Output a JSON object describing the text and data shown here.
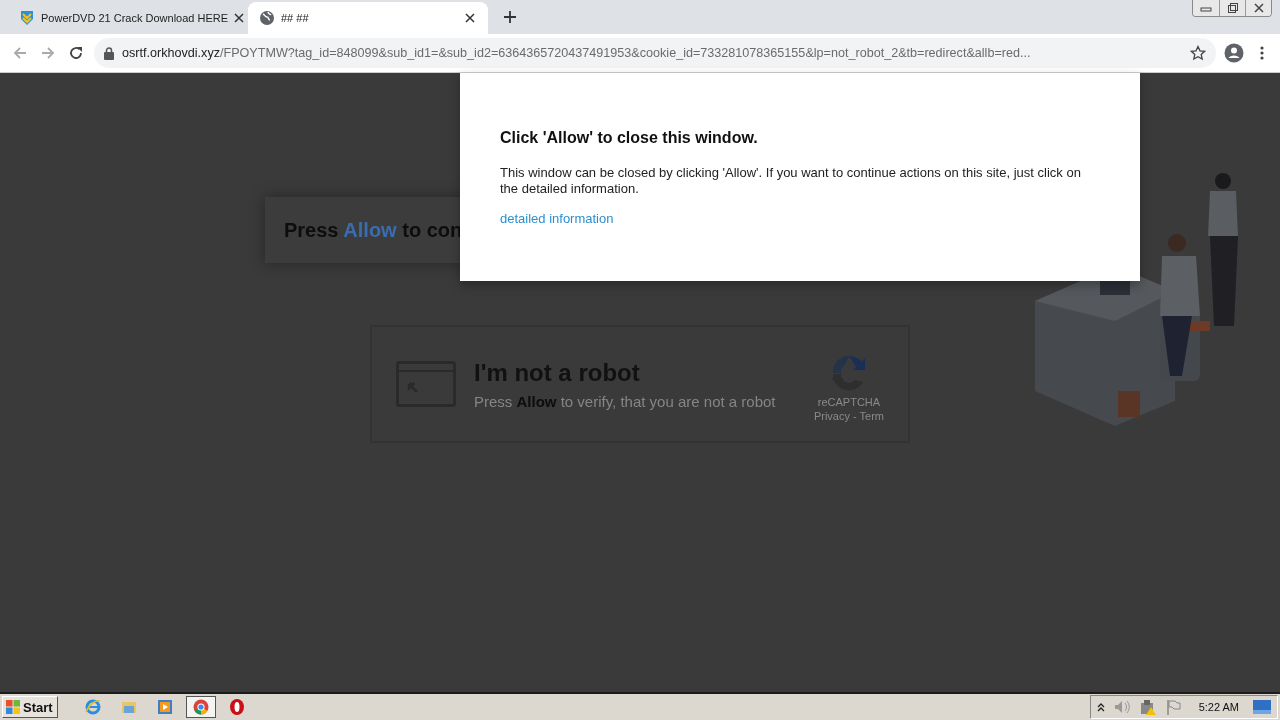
{
  "tabs": [
    {
      "label": "PowerDVD 21 Crack Download HERE",
      "kind": "shield",
      "selected": false
    },
    {
      "label": "## ##",
      "kind": "globe",
      "selected": true
    }
  ],
  "address_bar": {
    "host": "osrtf.orkhovdi.xyz",
    "path": "/FPOYTMW?tag_id=848099&sub_id1=&sub_id2=6364365720437491953&cookie_id=733281078365155&lp=not_robot_2&tb=redirect&allb=red..."
  },
  "page": {
    "press_card": {
      "before": "Press",
      "highlight": "Allow",
      "after": "to con"
    },
    "captcha": {
      "title": "I'm not a robot",
      "subtitle": "Press **Allow** to verify, that you are not a robot",
      "brand": "reCAPTCHA",
      "links": "Privacy - Term"
    }
  },
  "popup": {
    "title": "Click 'Allow' to close this window.",
    "body": "This window can be closed by clicking 'Allow'. If you want to continue actions on this site, just click on the detailed information.",
    "link": "detailed information"
  },
  "taskbar": {
    "start": "Start",
    "apps": [
      {
        "kind": "ie",
        "selected": false
      },
      {
        "kind": "explorer",
        "selected": false
      },
      {
        "kind": "media",
        "selected": false
      },
      {
        "kind": "chrome",
        "selected": true
      },
      {
        "kind": "opera",
        "selected": false
      }
    ],
    "time": "5:22 AM"
  }
}
